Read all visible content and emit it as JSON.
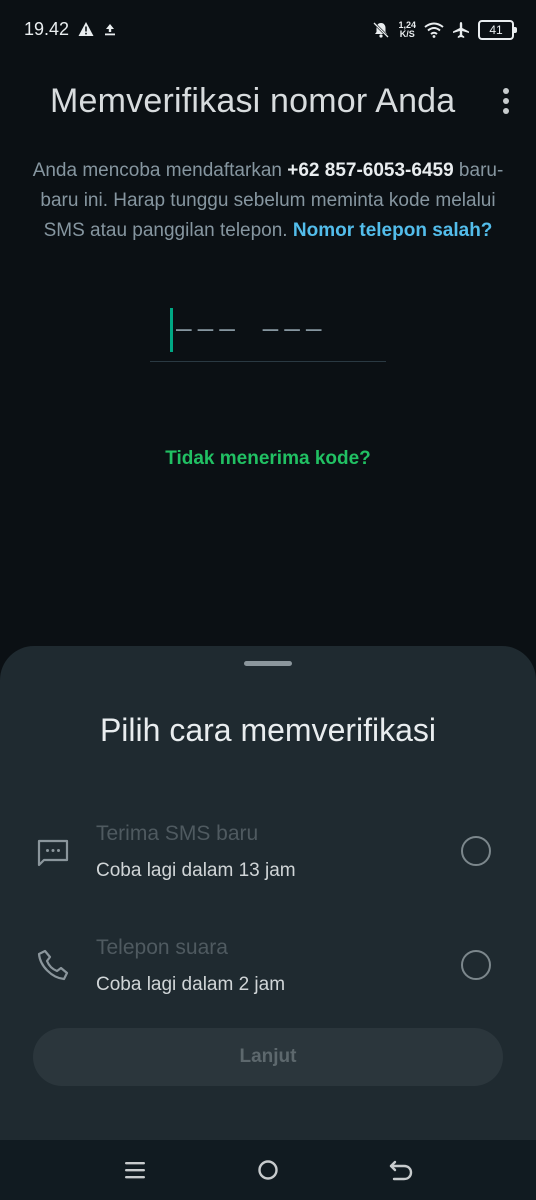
{
  "status_bar": {
    "time": "19.42",
    "speed_value": "1,24",
    "speed_unit": "K/S",
    "battery": "41"
  },
  "header": {
    "title": "Memverifikasi nomor Anda"
  },
  "description": {
    "line_prefix": "Anda mencoba mendaftarkan ",
    "phone": "+62 857-6053-6459",
    "line_suffix": " baru-baru ini. Harap tunggu sebelum meminta kode melalui SMS atau panggilan telepon. ",
    "wrong_number_link": "Nomor telepon salah?"
  },
  "code_input": {
    "mask": "———  ———"
  },
  "no_code_link": "Tidak menerima kode?",
  "sheet": {
    "title": "Pilih cara memverifikasi",
    "options": [
      {
        "icon": "sms-icon",
        "title": "Terima SMS baru",
        "subtitle": "Coba lagi dalam 13 jam",
        "selected": false
      },
      {
        "icon": "phone-icon",
        "title": "Telepon suara",
        "subtitle": "Coba lagi dalam 2 jam",
        "selected": false
      }
    ],
    "continue_label": "Lanjut"
  },
  "colors": {
    "background": "#0b1014",
    "sheet": "#1f2a30",
    "accent_green": "#21c063",
    "link_blue": "#53bdeb"
  }
}
